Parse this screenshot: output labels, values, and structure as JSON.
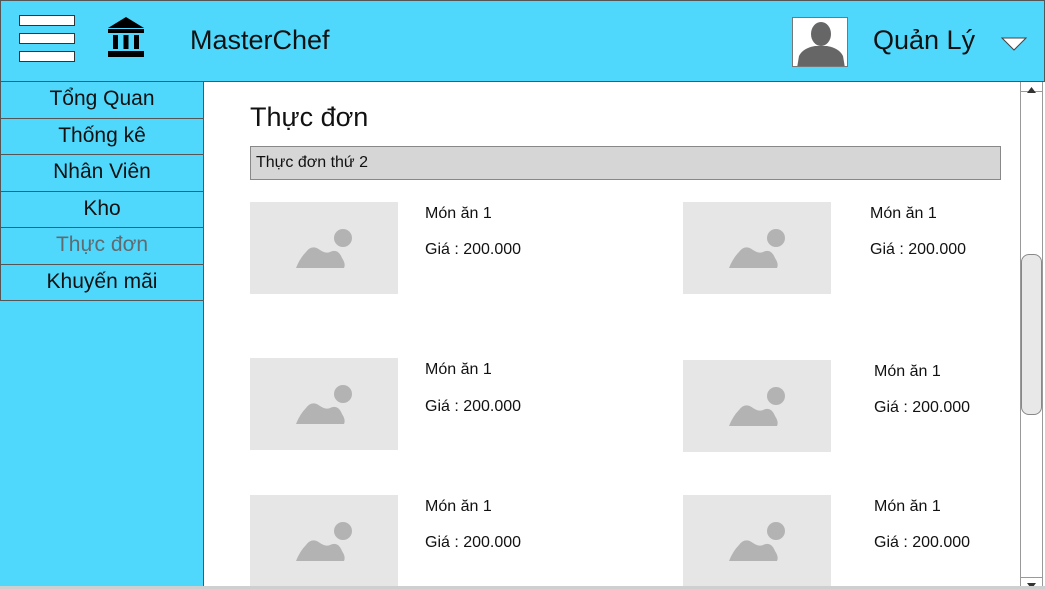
{
  "header": {
    "app_title": "MasterChef",
    "user_name": "Quản Lý",
    "background_color": "#4fd8fc",
    "icons": [
      "hamburger-menu-icon",
      "bank-icon",
      "user-avatar",
      "chevron-down-icon"
    ]
  },
  "sidebar": {
    "items": [
      {
        "label": "Tổng Quan"
      },
      {
        "label": "Thống kê"
      },
      {
        "label": "Nhân Viên"
      },
      {
        "label": "Kho"
      },
      {
        "label": "Thực đơn"
      },
      {
        "label": "Khuyến mãi"
      }
    ],
    "active_index": 4
  },
  "main": {
    "page_title": "Thực đơn",
    "selected_menu": "Thực đơn thứ 2",
    "dishes": [
      {
        "name": "Món ăn 1",
        "price": "Giá : 200.000"
      },
      {
        "name": "Món ăn 1",
        "price": "Giá : 200.000"
      },
      {
        "name": "Món ăn 1",
        "price": "Giá : 200.000"
      },
      {
        "name": "Món ăn 1",
        "price": "Giá : 200.000"
      },
      {
        "name": "Món ăn 1",
        "price": "Giá : 200.000"
      },
      {
        "name": "Món ăn 1",
        "price": "Giá : 200.000"
      }
    ]
  }
}
